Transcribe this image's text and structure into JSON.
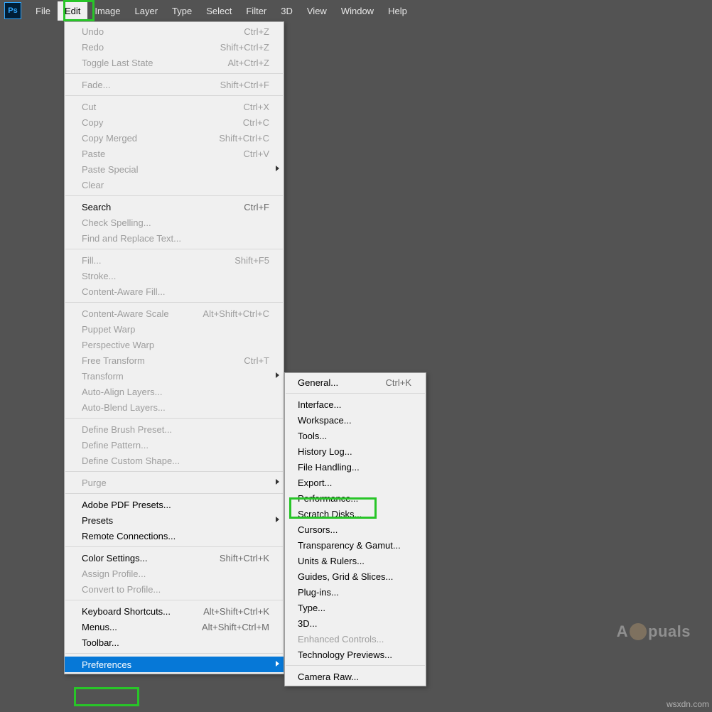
{
  "app_logo": "Ps",
  "menubar": {
    "items": [
      "File",
      "Edit",
      "Image",
      "Layer",
      "Type",
      "Select",
      "Filter",
      "3D",
      "View",
      "Window",
      "Help"
    ],
    "active_index": 1
  },
  "edit_menu": [
    {
      "label": "Undo",
      "shortcut": "Ctrl+Z",
      "disabled": true
    },
    {
      "label": "Redo",
      "shortcut": "Shift+Ctrl+Z",
      "disabled": true
    },
    {
      "label": "Toggle Last State",
      "shortcut": "Alt+Ctrl+Z",
      "disabled": true
    },
    {
      "sep": true
    },
    {
      "label": "Fade...",
      "shortcut": "Shift+Ctrl+F",
      "disabled": true
    },
    {
      "sep": true
    },
    {
      "label": "Cut",
      "shortcut": "Ctrl+X",
      "disabled": true
    },
    {
      "label": "Copy",
      "shortcut": "Ctrl+C",
      "disabled": true
    },
    {
      "label": "Copy Merged",
      "shortcut": "Shift+Ctrl+C",
      "disabled": true
    },
    {
      "label": "Paste",
      "shortcut": "Ctrl+V",
      "disabled": true
    },
    {
      "label": "Paste Special",
      "submenu": true,
      "disabled": true
    },
    {
      "label": "Clear",
      "disabled": true
    },
    {
      "sep": true
    },
    {
      "label": "Search",
      "shortcut": "Ctrl+F"
    },
    {
      "label": "Check Spelling...",
      "disabled": true
    },
    {
      "label": "Find and Replace Text...",
      "disabled": true
    },
    {
      "sep": true
    },
    {
      "label": "Fill...",
      "shortcut": "Shift+F5",
      "disabled": true
    },
    {
      "label": "Stroke...",
      "disabled": true
    },
    {
      "label": "Content-Aware Fill...",
      "disabled": true
    },
    {
      "sep": true
    },
    {
      "label": "Content-Aware Scale",
      "shortcut": "Alt+Shift+Ctrl+C",
      "disabled": true
    },
    {
      "label": "Puppet Warp",
      "disabled": true
    },
    {
      "label": "Perspective Warp",
      "disabled": true
    },
    {
      "label": "Free Transform",
      "shortcut": "Ctrl+T",
      "disabled": true
    },
    {
      "label": "Transform",
      "submenu": true,
      "disabled": true
    },
    {
      "label": "Auto-Align Layers...",
      "disabled": true
    },
    {
      "label": "Auto-Blend Layers...",
      "disabled": true
    },
    {
      "sep": true
    },
    {
      "label": "Define Brush Preset...",
      "disabled": true
    },
    {
      "label": "Define Pattern...",
      "disabled": true
    },
    {
      "label": "Define Custom Shape...",
      "disabled": true
    },
    {
      "sep": true
    },
    {
      "label": "Purge",
      "submenu": true,
      "disabled": true
    },
    {
      "sep": true
    },
    {
      "label": "Adobe PDF Presets..."
    },
    {
      "label": "Presets",
      "submenu": true
    },
    {
      "label": "Remote Connections..."
    },
    {
      "sep": true
    },
    {
      "label": "Color Settings...",
      "shortcut": "Shift+Ctrl+K"
    },
    {
      "label": "Assign Profile...",
      "disabled": true
    },
    {
      "label": "Convert to Profile...",
      "disabled": true
    },
    {
      "sep": true
    },
    {
      "label": "Keyboard Shortcuts...",
      "shortcut": "Alt+Shift+Ctrl+K"
    },
    {
      "label": "Menus...",
      "shortcut": "Alt+Shift+Ctrl+M"
    },
    {
      "label": "Toolbar..."
    },
    {
      "sep": true
    },
    {
      "label": "Preferences",
      "submenu": true,
      "selected": true
    }
  ],
  "prefs_menu": [
    {
      "label": "General...",
      "shortcut": "Ctrl+K"
    },
    {
      "sep": true
    },
    {
      "label": "Interface..."
    },
    {
      "label": "Workspace..."
    },
    {
      "label": "Tools..."
    },
    {
      "label": "History Log..."
    },
    {
      "label": "File Handling..."
    },
    {
      "label": "Export..."
    },
    {
      "label": "Performance..."
    },
    {
      "label": "Scratch Disks..."
    },
    {
      "label": "Cursors..."
    },
    {
      "label": "Transparency & Gamut..."
    },
    {
      "label": "Units & Rulers..."
    },
    {
      "label": "Guides, Grid & Slices..."
    },
    {
      "label": "Plug-ins..."
    },
    {
      "label": "Type..."
    },
    {
      "label": "3D..."
    },
    {
      "label": "Enhanced Controls...",
      "disabled": true
    },
    {
      "label": "Technology Previews..."
    },
    {
      "sep": true
    },
    {
      "label": "Camera Raw..."
    }
  ],
  "watermark": {
    "prefix": "A",
    "suffix": "puals"
  },
  "source": "wsxdn.com"
}
